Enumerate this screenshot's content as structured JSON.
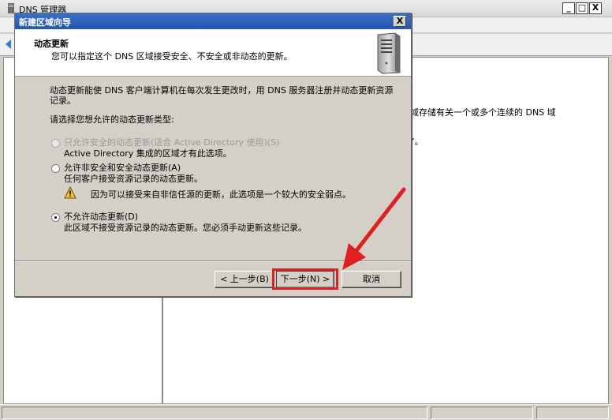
{
  "bg_window": {
    "title": "DNS 管理器",
    "min_label": "_",
    "max_label": "□",
    "close_label": "X",
    "content_line1": "域存储有关一个或多个连续的 DNS 域",
    "content_line2": "”。"
  },
  "dialog": {
    "title": "新建区域向导",
    "close_label": "X",
    "header": {
      "title": "动态更新",
      "subtitle": "您可以指定这个 DNS 区域接受安全、不安全或非动态的更新。",
      "icon": "server-icon"
    },
    "intro": "动态更新能使 DNS 客户端计算机在每次发生更改时，用 DNS 服务器注册并动态更新资源记录。",
    "prompt": "请选择您想允许的动态更新类型:",
    "options": [
      {
        "label": "只允许安全的动态更新(适合 Active Directory 使用)(S)",
        "desc": "Active Directory 集成的区域才有此选项。",
        "checked": false,
        "enabled": false
      },
      {
        "label": "允许非安全和安全动态更新(A)",
        "desc": "任何客户接受资源记录的动态更新。",
        "checked": false,
        "enabled": true
      },
      {
        "label": "不允许动态更新(D)",
        "desc": "此区域不接受资源记录的动态更新。您必须手动更新这些记录。",
        "checked": true,
        "enabled": true
      }
    ],
    "warning": {
      "icon": "warning-icon",
      "text": "因为可以接受来自非信任源的更新，此选项是一个较大的安全弱点。"
    },
    "buttons": {
      "back": "< 上一步(B)",
      "next": "下一步(N) >",
      "cancel": "取消"
    }
  },
  "colors": {
    "annotation": "#e02020",
    "dialog_title_bg": "#2456b0",
    "dialog_face": "#d4d0c8"
  }
}
